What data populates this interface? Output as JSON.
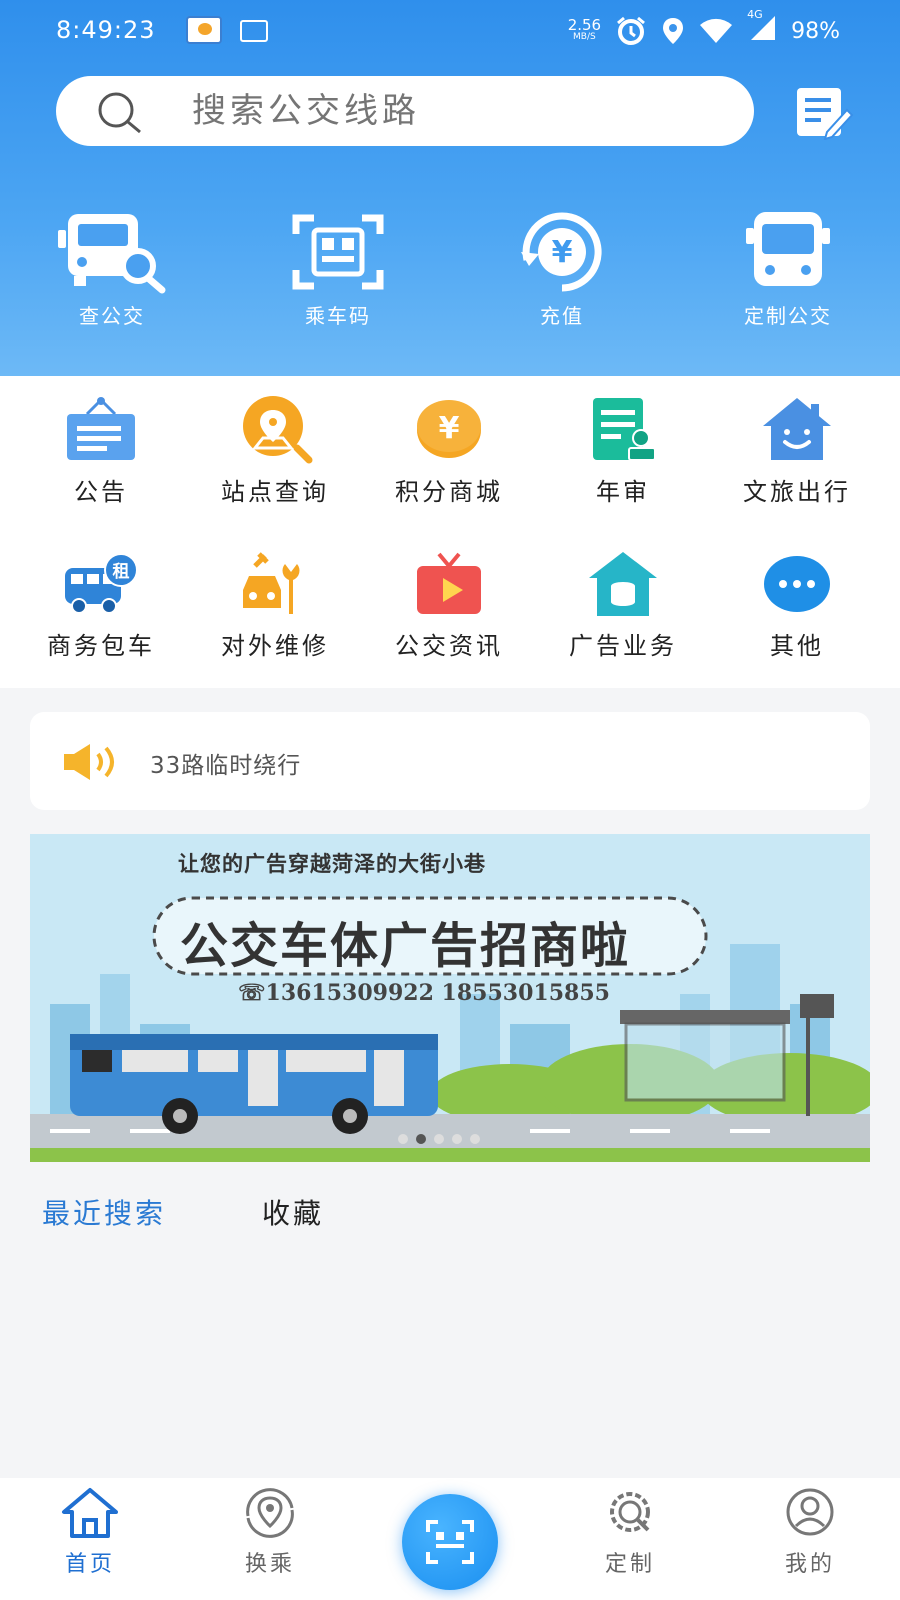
{
  "status_bar": {
    "time": "8:49:23",
    "net_speed_value": "2.56",
    "net_speed_unit": "MB/S",
    "battery": "98%",
    "signal_type": "4G"
  },
  "search": {
    "placeholder": "搜索公交线路"
  },
  "top_nav": [
    {
      "label": "查公交",
      "icon": "bus-search-icon"
    },
    {
      "label": "乘车码",
      "icon": "qr-code-icon"
    },
    {
      "label": "充值",
      "icon": "recharge-yen-icon"
    },
    {
      "label": "定制公交",
      "icon": "bus-icon"
    }
  ],
  "services": [
    {
      "label": "公告",
      "icon": "notice-board-icon",
      "color": "#4a90e2"
    },
    {
      "label": "站点查询",
      "icon": "location-search-icon",
      "color": "#f5a623"
    },
    {
      "label": "积分商城",
      "icon": "yen-coin-icon",
      "color": "#f5a623"
    },
    {
      "label": "年审",
      "icon": "document-stamp-icon",
      "color": "#1bbc9b"
    },
    {
      "label": "文旅出行",
      "icon": "smile-house-icon",
      "color": "#4a90e2"
    },
    {
      "label": "商务包车",
      "icon": "rental-bus-icon",
      "color": "#2f84d8"
    },
    {
      "label": "对外维修",
      "icon": "wrench-car-icon",
      "color": "#f5a623"
    },
    {
      "label": "公交资讯",
      "icon": "tv-play-icon",
      "color": "#ef5350"
    },
    {
      "label": "广告业务",
      "icon": "house-coin-icon",
      "color": "#26b5c8"
    },
    {
      "label": "其他",
      "icon": "more-dots-icon",
      "color": "#1f8fe6"
    }
  ],
  "notice": {
    "text": "33路临时绕行"
  },
  "banner": {
    "subtitle": "让您的广告穿越菏泽的大街小巷",
    "title": "公交车体广告招商啦",
    "phone": "☏13615309922 18553015855",
    "active_dot": 1,
    "dots": 5
  },
  "tabs": {
    "recent": "最近搜索",
    "favorites": "收藏"
  },
  "bottom_nav": [
    {
      "label": "首页",
      "active": true
    },
    {
      "label": "换乘",
      "active": false
    },
    {
      "label": "定制",
      "active": false
    },
    {
      "label": "我的",
      "active": false
    }
  ],
  "colors": {
    "primary": "#2f8fec",
    "active_tab": "#2a7ad3"
  }
}
